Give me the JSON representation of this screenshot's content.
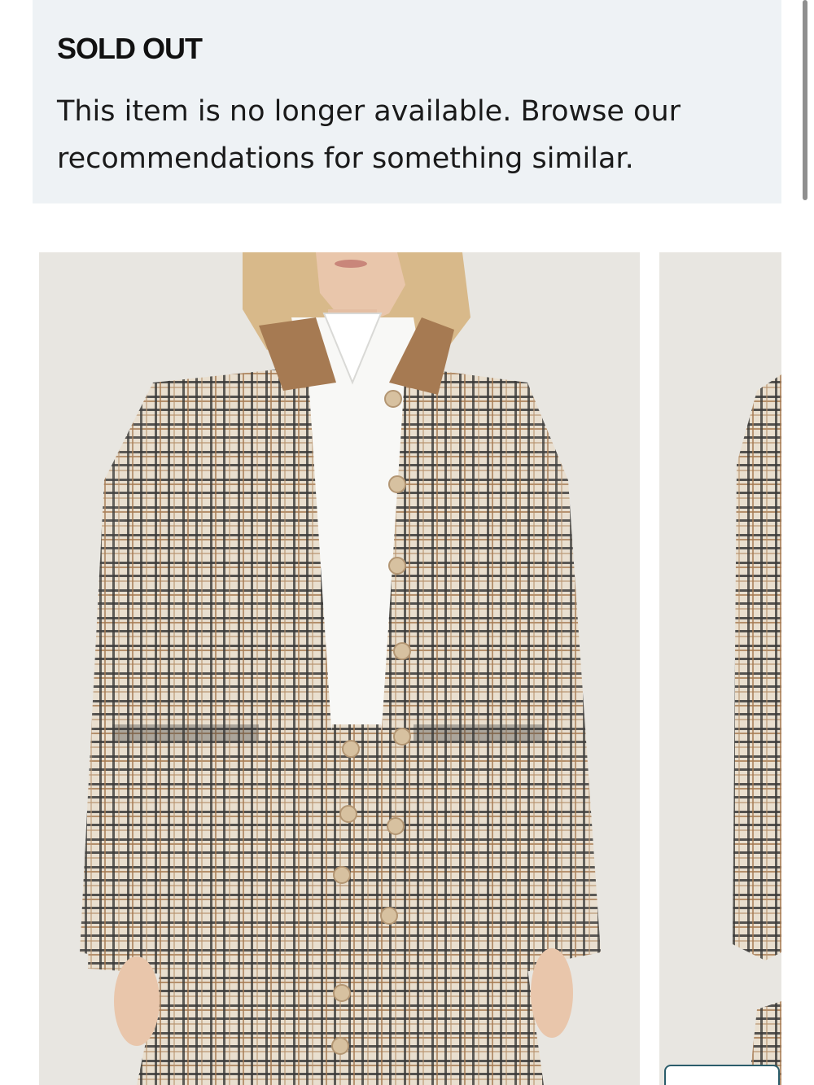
{
  "notice": {
    "title": "SOLD OUT",
    "message": "This item is no longer available. Browse our recommendations for something similar."
  },
  "colors": {
    "banner_background": "#eef2f5",
    "photo_background": "#e8e6e1",
    "plaid_base": "#e7ddcc",
    "collar": "#a67a52",
    "shirt": "#ffffff",
    "button_outline": "#2b5d6b"
  },
  "carousel": {
    "images": [
      {
        "alt": "product-photo-main"
      },
      {
        "alt": "product-photo-next"
      }
    ]
  }
}
